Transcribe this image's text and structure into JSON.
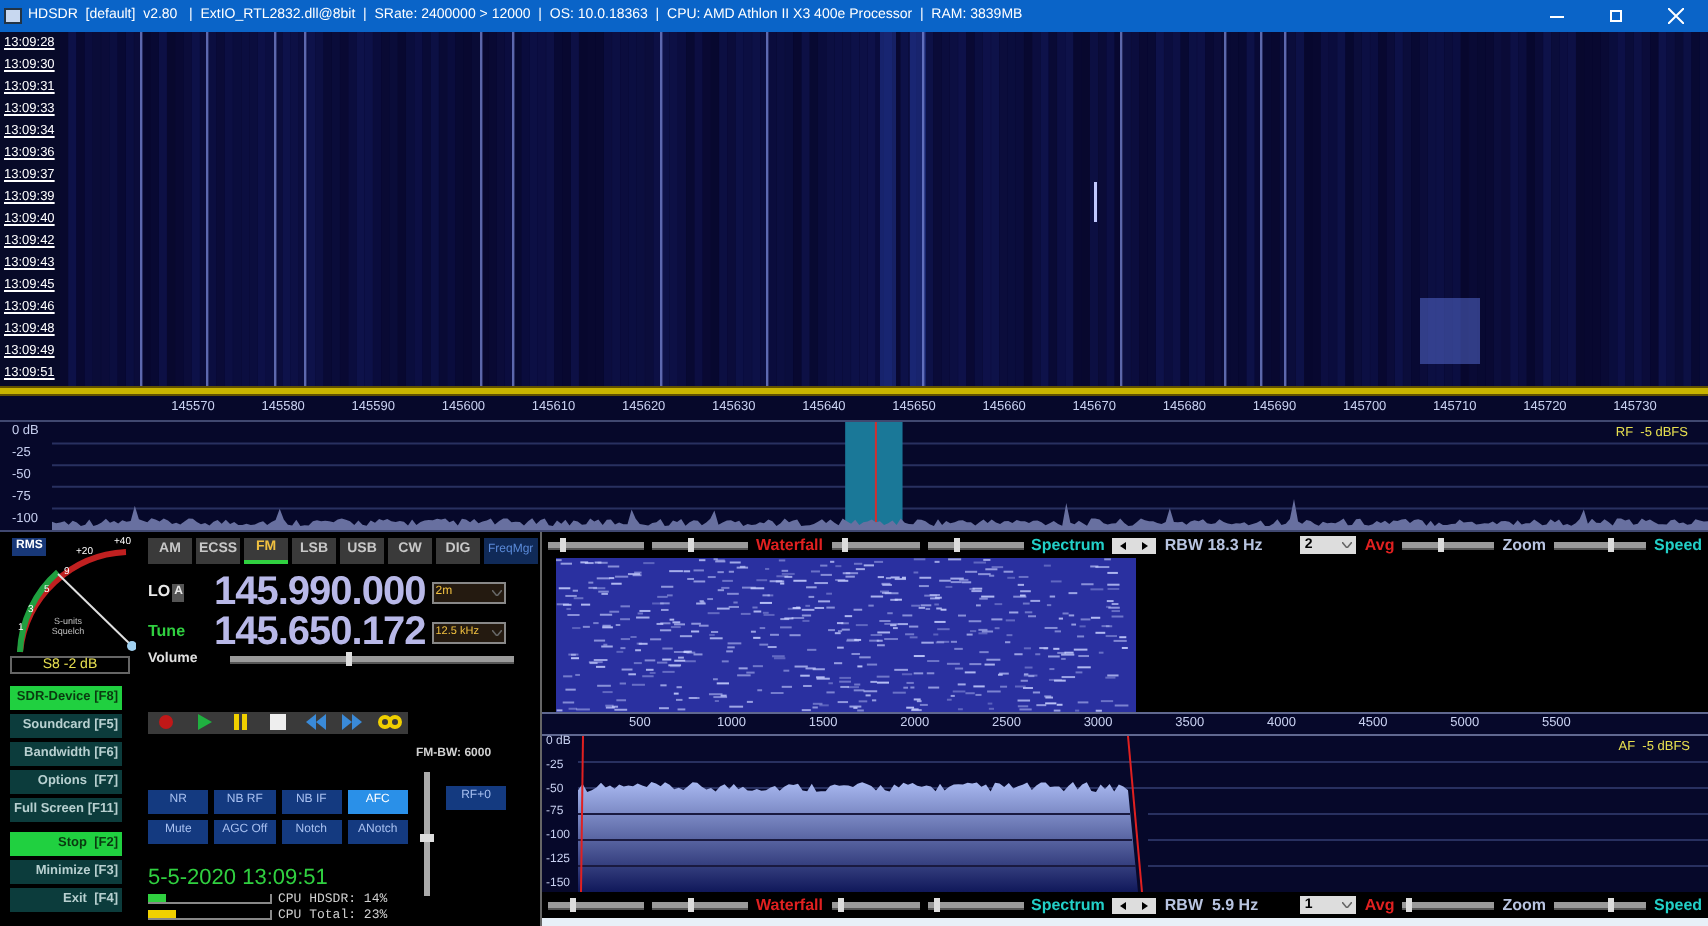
{
  "window": {
    "title": "HDSDR  [default]  v2.80   |  ExtIO_RTL2832.dll@8bit  |  SRate: 2400000 > 12000  |  OS: 10.0.18363  |  CPU: AMD Athlon II X3 400e Processor  |  RAM: 3839MB"
  },
  "waterfall": {
    "timestamps": [
      "13:09:28",
      "13:09:30",
      "13:09:31",
      "13:09:33",
      "13:09:34",
      "13:09:36",
      "13:09:37",
      "13:09:39",
      "13:09:40",
      "13:09:42",
      "13:09:43",
      "13:09:45",
      "13:09:46",
      "13:09:48",
      "13:09:49",
      "13:09:51"
    ]
  },
  "freq_axis": {
    "labels": [
      "145570",
      "145580",
      "145590",
      "145600",
      "145610",
      "145620",
      "145630",
      "145640",
      "145650",
      "145660",
      "145670",
      "145680",
      "145690",
      "145700",
      "145710",
      "145720",
      "145730"
    ]
  },
  "rf_spectrum": {
    "y_labels": [
      "0 dB",
      "-25",
      "-50",
      "-75",
      "-100"
    ],
    "reading": "RF  -5 dBFS"
  },
  "smeter": {
    "mode": "RMS",
    "scale": [
      "+40",
      "+20",
      "9",
      "5",
      "3",
      "1"
    ],
    "caption": "S-units Squelch",
    "reading": "S8 -2 dB"
  },
  "modes": [
    {
      "label": "AM",
      "selected": false
    },
    {
      "label": "ECSS",
      "selected": false
    },
    {
      "label": "FM",
      "selected": true
    },
    {
      "label": "LSB",
      "selected": false
    },
    {
      "label": "USB",
      "selected": false
    },
    {
      "label": "CW",
      "selected": false
    },
    {
      "label": "DIG",
      "selected": false
    }
  ],
  "freq_mgr": "FreqMgr",
  "lo": {
    "label": "LO",
    "badge": "A",
    "value": "145.990.000",
    "band": "2m"
  },
  "tune": {
    "label": "Tune",
    "value": "145.650.172",
    "step": "12.5 kHz"
  },
  "volume": {
    "label": "Volume",
    "level": 0.42
  },
  "side_buttons": [
    {
      "label": "SDR-Device [F8]",
      "on": true
    },
    {
      "label": "Soundcard [F5]",
      "on": false
    },
    {
      "label": "Bandwidth [F6]",
      "on": false
    },
    {
      "label": "Options  [F7]",
      "on": false
    },
    {
      "label": "Full Screen [F11]",
      "on": false
    },
    {
      "label": "Stop  [F2]",
      "on": true
    },
    {
      "label": "Minimize [F3]",
      "on": false
    },
    {
      "label": "Exit  [F4]",
      "on": false
    }
  ],
  "transport": [
    {
      "kind": "record"
    },
    {
      "kind": "play"
    },
    {
      "kind": "pause"
    },
    {
      "kind": "stop"
    },
    {
      "kind": "rewind"
    },
    {
      "kind": "forward"
    },
    {
      "kind": "loop"
    }
  ],
  "dsp_buttons": [
    {
      "label": "NR",
      "on": false
    },
    {
      "label": "NB RF",
      "on": false
    },
    {
      "label": "NB IF",
      "on": false
    },
    {
      "label": "AFC",
      "on": true
    },
    {
      "label": "Mute",
      "on": false
    },
    {
      "label": "AGC Off",
      "on": false
    },
    {
      "label": "Notch",
      "on": false
    },
    {
      "label": "ANotch",
      "on": false
    }
  ],
  "rf_gain": "RF+0",
  "fm_bw": {
    "label": "FM-BW: 6000",
    "level": 0.45
  },
  "datetime": "5-5-2020 13:09:51",
  "cpu": [
    {
      "label": "CPU HDSDR:",
      "value": "14%",
      "level": 0.14
    },
    {
      "label": "CPU Total:",
      "value": "23%",
      "level": 0.23
    }
  ],
  "control_rows": [
    {
      "sliders": [
        {
          "level": 0.15
        },
        {
          "level": 0.4
        },
        {
          "level": 0.15
        },
        {
          "level": 0.3
        },
        {
          "level": 0.4
        },
        {
          "level": 0.6
        }
      ],
      "waterfall": "Waterfall",
      "spectrum": "Spectrum",
      "rbw": "RBW 18.3 Hz",
      "avg_value": "2",
      "avg": "Avg",
      "zoom": "Zoom",
      "speed": "Speed"
    }
  ],
  "audio_axis": {
    "labels": [
      "500",
      "1000",
      "1500",
      "2000",
      "2500",
      "3000",
      "3500",
      "4000",
      "4500",
      "5000",
      "5500"
    ]
  },
  "af_spectrum": {
    "y_labels": [
      "0 dB",
      "-25",
      "-50",
      "-75",
      "-100",
      "-125",
      "-150"
    ],
    "reading": "AF  -5 dBFS"
  },
  "bottom_row": {
    "sliders": [
      {
        "level": 0.25
      },
      {
        "level": 0.4
      },
      {
        "level": 0.1
      },
      {
        "level": 0.1
      },
      {
        "level": 0.05
      },
      {
        "level": 0.6
      }
    ],
    "waterfall": "Waterfall",
    "spectrum": "Spectrum",
    "rbw": "RBW  5.9 Hz",
    "avg_value": "1",
    "avg": "Avg",
    "zoom": "Zoom",
    "speed": "Speed"
  }
}
